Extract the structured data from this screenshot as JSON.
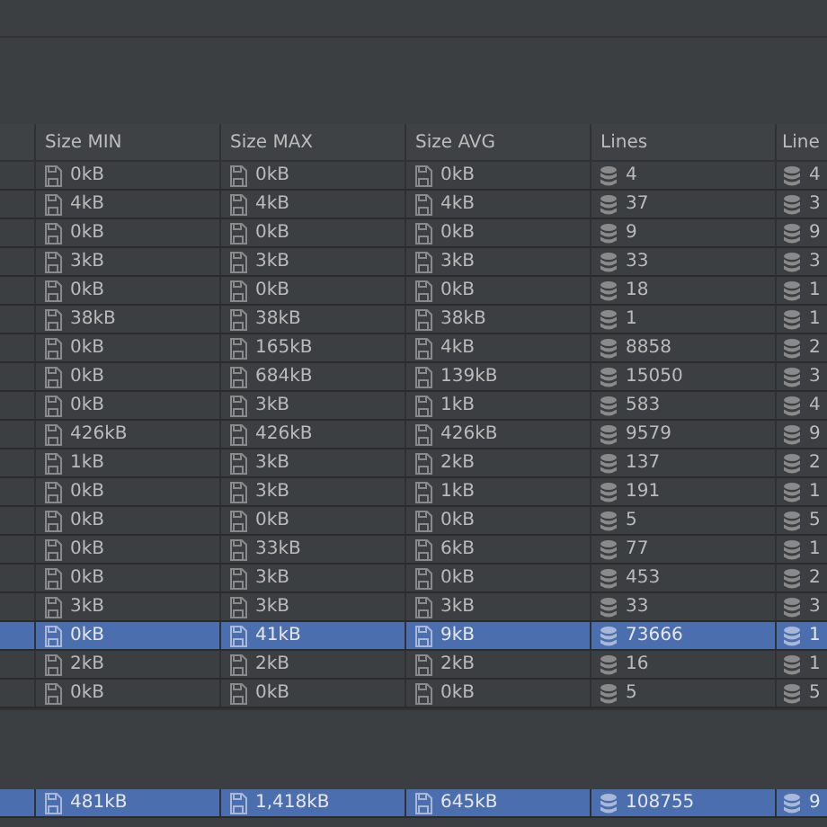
{
  "table": {
    "columns": [
      {
        "label": "Size MIN",
        "kind": "size"
      },
      {
        "label": "Size MAX",
        "kind": "size"
      },
      {
        "label": "Size AVG",
        "kind": "size"
      },
      {
        "label": "Lines",
        "kind": "lines"
      },
      {
        "label": "Line",
        "kind": "lines"
      }
    ],
    "rows": [
      {
        "selected": false,
        "cells": [
          "0kB",
          "0kB",
          "0kB",
          "4",
          "4"
        ]
      },
      {
        "selected": false,
        "cells": [
          "4kB",
          "4kB",
          "4kB",
          "37",
          "3"
        ]
      },
      {
        "selected": false,
        "cells": [
          "0kB",
          "0kB",
          "0kB",
          "9",
          "9"
        ]
      },
      {
        "selected": false,
        "cells": [
          "3kB",
          "3kB",
          "3kB",
          "33",
          "3"
        ]
      },
      {
        "selected": false,
        "cells": [
          "0kB",
          "0kB",
          "0kB",
          "18",
          "1"
        ]
      },
      {
        "selected": false,
        "cells": [
          "38kB",
          "38kB",
          "38kB",
          "1",
          "1"
        ]
      },
      {
        "selected": false,
        "cells": [
          "0kB",
          "165kB",
          "4kB",
          "8858",
          "2"
        ]
      },
      {
        "selected": false,
        "cells": [
          "0kB",
          "684kB",
          "139kB",
          "15050",
          "3"
        ]
      },
      {
        "selected": false,
        "cells": [
          "0kB",
          "3kB",
          "1kB",
          "583",
          "4"
        ]
      },
      {
        "selected": false,
        "cells": [
          "426kB",
          "426kB",
          "426kB",
          "9579",
          "9"
        ]
      },
      {
        "selected": false,
        "cells": [
          "1kB",
          "3kB",
          "2kB",
          "137",
          "2"
        ]
      },
      {
        "selected": false,
        "cells": [
          "0kB",
          "3kB",
          "1kB",
          "191",
          "1"
        ]
      },
      {
        "selected": false,
        "cells": [
          "0kB",
          "0kB",
          "0kB",
          "5",
          "5"
        ]
      },
      {
        "selected": false,
        "cells": [
          "0kB",
          "33kB",
          "6kB",
          "77",
          "1"
        ]
      },
      {
        "selected": false,
        "cells": [
          "0kB",
          "3kB",
          "0kB",
          "453",
          "2"
        ]
      },
      {
        "selected": false,
        "cells": [
          "3kB",
          "3kB",
          "3kB",
          "33",
          "3"
        ]
      },
      {
        "selected": true,
        "cells": [
          "0kB",
          "41kB",
          "9kB",
          "73666",
          "1"
        ]
      },
      {
        "selected": false,
        "cells": [
          "2kB",
          "2kB",
          "2kB",
          "16",
          "1"
        ]
      },
      {
        "selected": false,
        "cells": [
          "0kB",
          "0kB",
          "0kB",
          "5",
          "5"
        ]
      }
    ],
    "total": {
      "selected": true,
      "cells": [
        "481kB",
        "1,418kB",
        "645kB",
        "108755",
        "9"
      ]
    }
  }
}
